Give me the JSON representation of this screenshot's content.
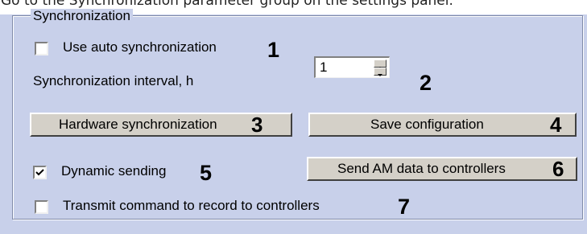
{
  "header": {
    "caption_fragment": "Go to the Synchronization parameter group on the settings panel."
  },
  "group": {
    "title": "Synchronization"
  },
  "auto_sync": {
    "label": "Use auto synchronization",
    "marker": "1",
    "checked": false
  },
  "interval": {
    "label": "Synchronization interval, h",
    "value": "1",
    "marker": "2"
  },
  "hardware_sync": {
    "label": "Hardware synchronization",
    "marker": "3"
  },
  "save_config": {
    "label": "Save configuration",
    "marker": "4"
  },
  "dynamic_sending": {
    "label": "Dynamic sending",
    "marker": "5",
    "checked": true
  },
  "send_am": {
    "label": "Send AM data to controllers",
    "marker": "6"
  },
  "transmit_record": {
    "label": "Transmit command to record to controllers",
    "marker": "7",
    "checked": false
  },
  "icons": {
    "spin_up": "spin-up-arrow-icon",
    "spin_down": "spin-down-arrow-icon",
    "check": "checkmark-icon"
  },
  "colors": {
    "panel_bg": "#c8d0ea",
    "button_face": "#d4d0c8"
  }
}
